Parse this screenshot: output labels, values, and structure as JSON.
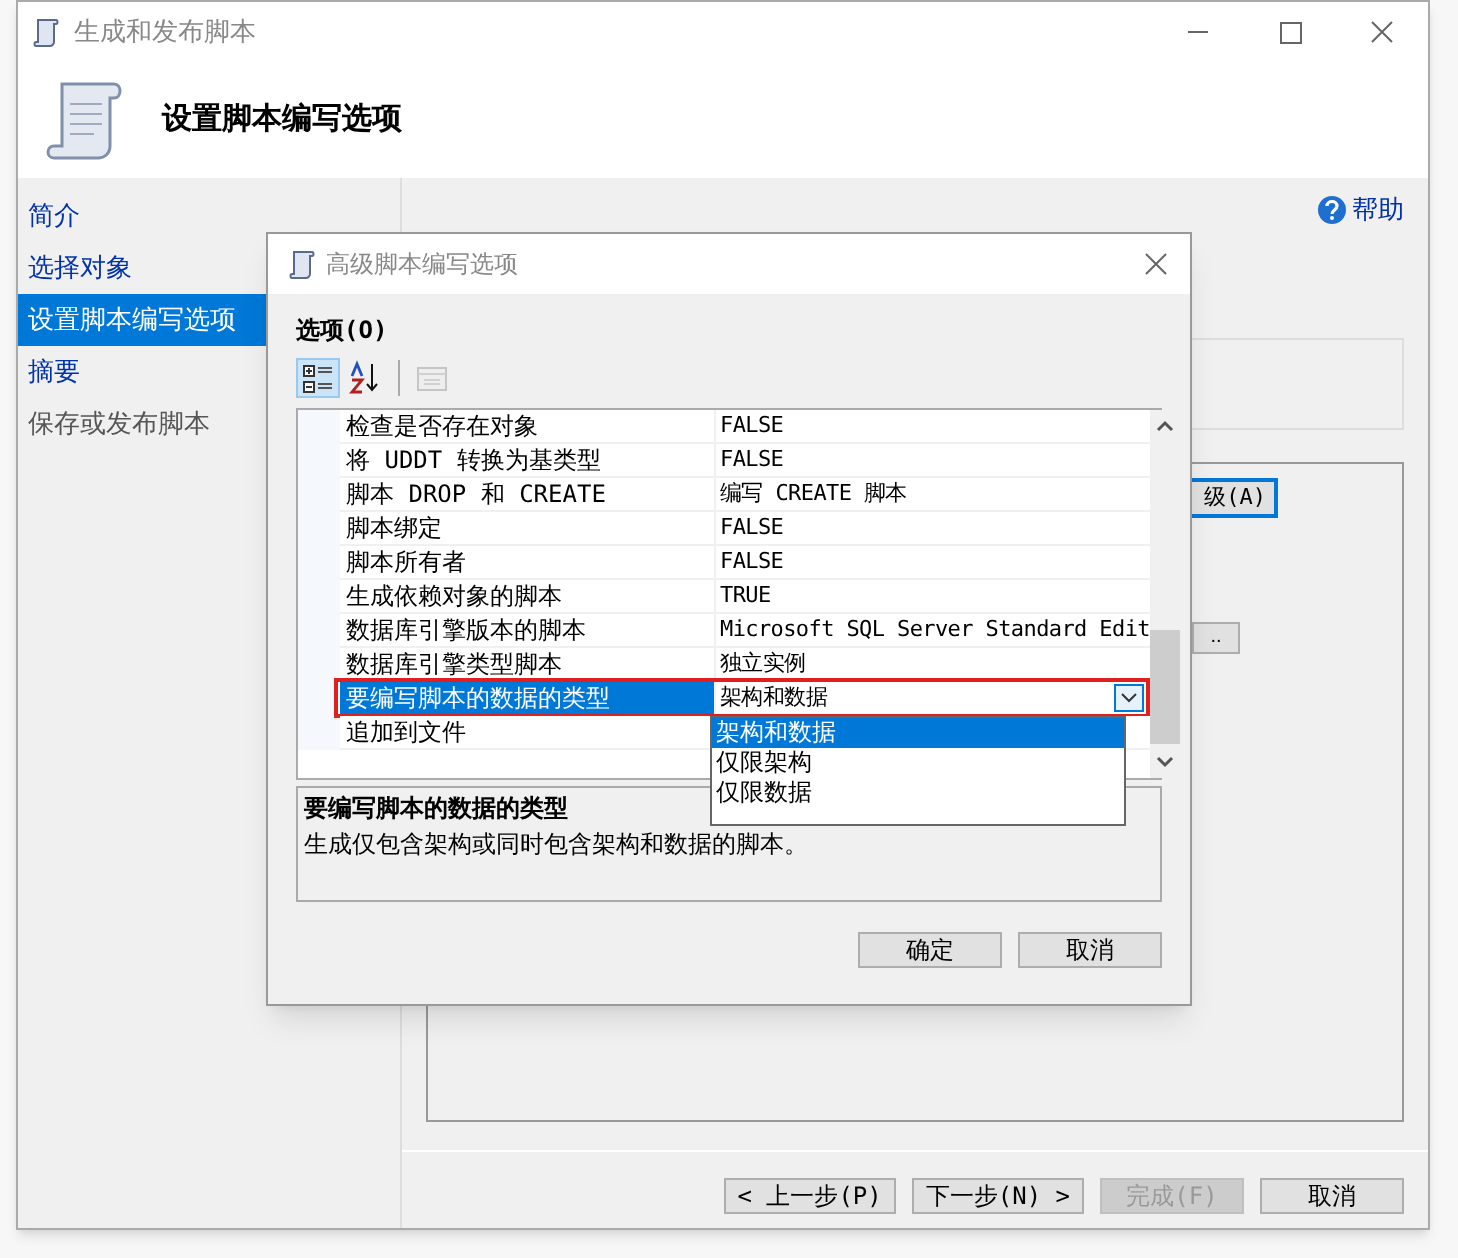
{
  "window": {
    "title": "生成和发布脚本",
    "heading": "设置脚本编写选项"
  },
  "nav": [
    {
      "label": "简介",
      "selected": false,
      "disabled": false
    },
    {
      "label": "选择对象",
      "selected": false,
      "disabled": false
    },
    {
      "label": "设置脚本编写选项",
      "selected": true,
      "disabled": false
    },
    {
      "label": "摘要",
      "selected": false,
      "disabled": false
    },
    {
      "label": "保存或发布脚本",
      "selected": false,
      "disabled": true
    }
  ],
  "help": "帮助",
  "advanced_button": "级(A)",
  "browse_button": "..",
  "footer_buttons": [
    {
      "label": "< 上一步(P)",
      "disabled": false
    },
    {
      "label": "下一步(N) >",
      "disabled": false
    },
    {
      "label": "完成(F)",
      "disabled": true
    },
    {
      "label": "取消",
      "disabled": false
    }
  ],
  "dialog": {
    "title": "高级脚本编写选项",
    "options_label": "选项(O)",
    "toolbar": [
      {
        "kind": "categorized",
        "selected": true,
        "disabled": false
      },
      {
        "kind": "alphabetical",
        "selected": false,
        "disabled": false
      },
      {
        "kind": "property_pages",
        "selected": false,
        "disabled": true
      }
    ],
    "properties": [
      {
        "name": "检查是否存在对象",
        "value": "FALSE",
        "selected": false,
        "highlighted": false
      },
      {
        "name": "将 UDDT 转换为基类型",
        "value": "FALSE",
        "selected": false,
        "highlighted": false
      },
      {
        "name": "脚本 DROP 和 CREATE",
        "value": "编写 CREATE 脚本",
        "selected": false,
        "highlighted": false
      },
      {
        "name": "脚本绑定",
        "value": "FALSE",
        "selected": false,
        "highlighted": false
      },
      {
        "name": "脚本所有者",
        "value": "FALSE",
        "selected": false,
        "highlighted": false
      },
      {
        "name": "生成依赖对象的脚本",
        "value": "TRUE",
        "selected": false,
        "highlighted": false
      },
      {
        "name": "数据库引擎版本的脚本",
        "value": "Microsoft SQL Server Standard Edit",
        "selected": false,
        "highlighted": false
      },
      {
        "name": "数据库引擎类型脚本",
        "value": "独立实例",
        "selected": false,
        "highlighted": false
      },
      {
        "name": "要编写脚本的数据的类型",
        "value": "架构和数据",
        "selected": true,
        "highlighted": true,
        "dropdown": {
          "open": true,
          "options": [
            {
              "label": "架构和数据",
              "selected": true
            },
            {
              "label": "仅限架构",
              "selected": false
            },
            {
              "label": "仅限数据",
              "selected": false
            }
          ]
        }
      },
      {
        "name": "追加到文件",
        "selected": false,
        "highlighted": false
      }
    ],
    "description": {
      "title": "要编写脚本的数据的类型",
      "text": "生成仅包含架构或同时包含架构和数据的脚本。"
    },
    "buttons": [
      {
        "label": "确定"
      },
      {
        "label": "取消"
      }
    ]
  }
}
